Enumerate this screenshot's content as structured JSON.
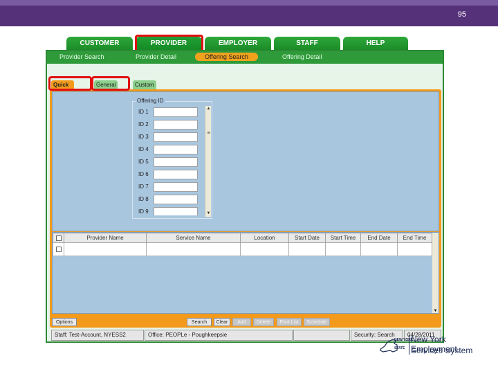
{
  "slide": {
    "number": "95"
  },
  "main_tabs": [
    {
      "label": "CUSTOMER"
    },
    {
      "label": "PROVIDER"
    },
    {
      "label": "EMPLOYER"
    },
    {
      "label": "STAFF"
    },
    {
      "label": "HELP"
    }
  ],
  "sub_nav": [
    {
      "label": "Provider Search"
    },
    {
      "label": "Provider Detail"
    },
    {
      "label": "Offering Search"
    },
    {
      "label": "Offering Detail"
    }
  ],
  "inner_tabs": [
    {
      "label": "Quick Search"
    },
    {
      "label": "General Info"
    },
    {
      "label": "Custom"
    }
  ],
  "offering_id": {
    "legend": "Offering ID",
    "fields": [
      {
        "label": "ID 1",
        "value": ""
      },
      {
        "label": "ID 2",
        "value": ""
      },
      {
        "label": "ID 3",
        "value": ""
      },
      {
        "label": "ID 4",
        "value": ""
      },
      {
        "label": "ID 5",
        "value": ""
      },
      {
        "label": "ID 6",
        "value": ""
      },
      {
        "label": "ID 7",
        "value": ""
      },
      {
        "label": "ID 8",
        "value": ""
      },
      {
        "label": "ID 9",
        "value": ""
      }
    ]
  },
  "results_table": {
    "columns": [
      "Provider Name",
      "Service Name",
      "Location",
      "Start Date",
      "Start Time",
      "End Date",
      "End Time"
    ],
    "rows": [
      [
        "",
        "",
        "",
        "",
        "",
        "",
        ""
      ]
    ]
  },
  "buttons": {
    "options": "Options",
    "search": "Search",
    "clear": "Clear",
    "add": "Add",
    "delete": "Delete",
    "print_list": "Print List",
    "schedule": "Schedule"
  },
  "status_bar": {
    "staff": "Staff: Test-Account, NYESS2",
    "office": "Office: PEOPLe - Poughkeepsie",
    "blank": "",
    "security": "Security: Search",
    "date": "04/28/2011"
  },
  "logo": {
    "new_york": "NEW YORK",
    "state": "STATE",
    "line1": "New York Employment",
    "line2": "Services System"
  },
  "colors": {
    "header_purple": "#55317a",
    "tab_green": "#1f9a2f",
    "active_orange": "#f39a1c",
    "highlight_red": "#e01010",
    "panel_blue": "#a9c6df"
  }
}
